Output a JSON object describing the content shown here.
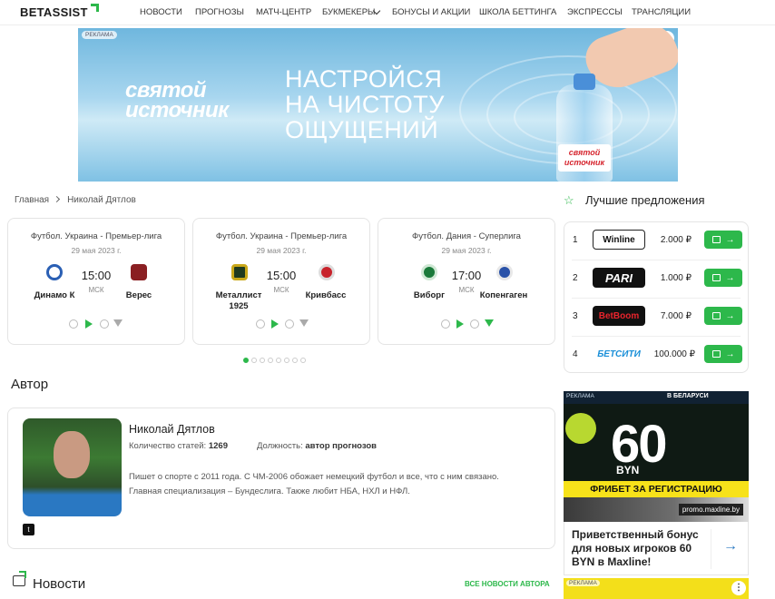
{
  "nav": {
    "logo": "BETASSIST",
    "items": [
      "Новости",
      "Прогнозы",
      "Матч-центр",
      "Букмекеры",
      "Бонусы и акции",
      "Школа беттинга",
      "Экспрессы",
      "Трансляции"
    ]
  },
  "banner": {
    "ad_label": "РЕКЛАМА",
    "brand": "святой источник",
    "slogan_lines": [
      "НАСТРОЙСЯ",
      "НА ЧИСТОТУ",
      "ОЩУЩЕНИЙ"
    ],
    "bottle_label": "святой источник"
  },
  "breadcrumbs": [
    "Главная",
    "Николай Дятлов"
  ],
  "matches": [
    {
      "league": "Футбол. Украина - Премьер-лига",
      "date": "29 мая 2023 г.",
      "time": "15:00",
      "tz": "МСК",
      "home": "Динамо К",
      "away": "Верес",
      "home_color": "#2a5fb4",
      "away_color": "#8a1f22"
    },
    {
      "league": "Футбол. Украина - Премьер-лига",
      "date": "29 мая 2023 г.",
      "time": "15:00",
      "tz": "МСК",
      "home": "Металлист 1925",
      "away": "Кривбасс",
      "home_color": "#c9a81a",
      "away_color": "#c8232c"
    },
    {
      "league": "Футбол. Дания - Суперлига",
      "date": "29 мая 2023 г.",
      "time": "17:00",
      "tz": "МСК",
      "home": "Виборг",
      "away": "Копенгаген",
      "home_color": "#1a7a3a",
      "away_color": "#2a52a8"
    }
  ],
  "author_section": {
    "title": "Автор",
    "name": "Николай Дятлов",
    "articles_label": "Количество статей:",
    "articles_value": "1269",
    "position_label": "Должность:",
    "position_value": "автор прогнозов",
    "bio": "Пишет о спорте с 2011 года. С ЧМ-2006 обожает немецкий футбол и все, что с ним связано. Главная специализация – Бундеслига. Также любит НБА, НХЛ и НФЛ."
  },
  "news": {
    "title": "Новости",
    "all_link": "ВСЕ НОВОСТИ АВТОРА"
  },
  "best_offers": {
    "title": "Лучшие предложения",
    "items": [
      {
        "rank": "1",
        "bookmaker": "Winline",
        "amount": "2.000 ₽",
        "bg": "#ffffff",
        "fg": "#111111"
      },
      {
        "rank": "2",
        "bookmaker": "PARI",
        "amount": "1.000 ₽",
        "bg": "#111111",
        "fg": "#ffffff"
      },
      {
        "rank": "3",
        "bookmaker": "BetBoom",
        "amount": "7.000 ₽",
        "bg": "#111111",
        "fg": "#e8242c"
      },
      {
        "rank": "4",
        "bookmaker": "БЕТСИТИ",
        "amount": "100.000 ₽",
        "bg": "#ffffff",
        "fg": "#1a8fd8"
      }
    ]
  },
  "side_ad": {
    "label": "РЕКЛАМА",
    "top_text": "В БЕЛАРУСИ",
    "amount": "60",
    "currency": "BYN",
    "band": "ФРИБЕТ ЗА РЕГИСТРАЦИЮ",
    "url": "promo.maxline.by"
  },
  "promo": {
    "text": "Приветственный бонус для новых игроков 60 BYN в Maxline!"
  },
  "second_ad": {
    "label": "РЕКЛАМА"
  },
  "accent": "#2db84b"
}
